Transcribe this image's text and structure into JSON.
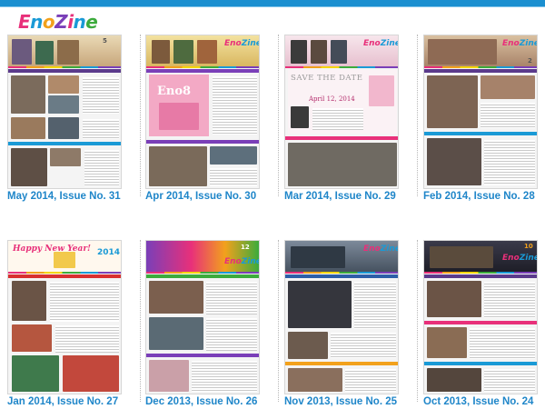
{
  "logo": {
    "text": "EnoZine"
  },
  "colors": {
    "accent": "#1a8fd0",
    "caption": "#1f86c9",
    "brand_pink": "#e8307a"
  },
  "issues": [
    {
      "caption": "May 2014, Issue No. 31",
      "cover_number": "5"
    },
    {
      "caption": "Apr 2014, Issue No. 30",
      "cover_number": "",
      "poster_text": "Eno8"
    },
    {
      "caption": "Mar 2014, Issue No. 29",
      "cover_number": "",
      "poster_text": "SAVE THE DATE",
      "poster_date": "April 12, 2014"
    },
    {
      "caption": "Feb 2014, Issue No. 28",
      "cover_number": "2"
    },
    {
      "caption": "Jan 2014, Issue No. 27",
      "cover_number": "2014",
      "poster_text": "Happy New Year!"
    },
    {
      "caption": "Dec 2013, Issue No. 26",
      "cover_number": "12"
    },
    {
      "caption": "Nov 2013, Issue No. 25",
      "cover_number": ""
    },
    {
      "caption": "Oct 2013, Issue No. 24",
      "cover_number": "10"
    }
  ]
}
